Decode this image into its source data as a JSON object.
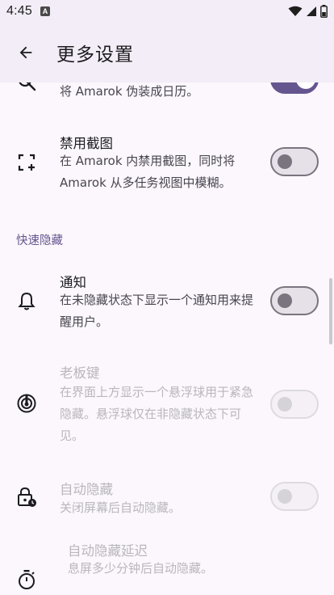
{
  "status_bar": {
    "time": "4:45",
    "icons": [
      "keyboard-a-icon",
      "wifi-icon",
      "signal-icon",
      "battery-icon"
    ]
  },
  "app_bar": {
    "back_icon": "arrow-back-icon",
    "title": "更多设置"
  },
  "rows": {
    "disguise": {
      "subtitle": "将 Amarok 伪装成日历。",
      "switch_on": true
    },
    "screenshot": {
      "title": "禁用截图",
      "subtitle": "在 Amarok 内禁用截图，同时将 Amarok 从多任务视图中模糊。",
      "switch_on": false
    },
    "section_quick_hide": "快速隐藏",
    "notification": {
      "title": "通知",
      "subtitle": "在未隐藏状态下显示一个通知用来提醒用户。",
      "switch_on": false
    },
    "boss_key": {
      "title": "老板键",
      "subtitle": "在界面上方显示一个悬浮球用于紧急隐藏。悬浮球仅在非隐藏状态下可见。",
      "switch_on": false,
      "enabled": false
    },
    "auto_hide": {
      "title": "自动隐藏",
      "subtitle": "关闭屏幕后自动隐藏。",
      "switch_on": false,
      "enabled": false
    },
    "auto_hide_delay": {
      "title": "自动隐藏延迟",
      "subtitle": "息屏多少分钟后自动隐藏。",
      "enabled": false
    }
  },
  "colors": {
    "accent": "#65558f",
    "background": "#fbf7fc",
    "app_bar": "#f3edf7"
  }
}
